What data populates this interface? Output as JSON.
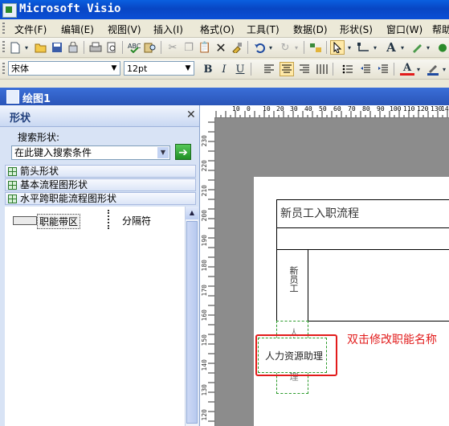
{
  "window": {
    "title": "Microsoft Visio"
  },
  "menu": [
    "文件(F)",
    "编辑(E)",
    "视图(V)",
    "插入(I)",
    "格式(O)",
    "工具(T)",
    "数据(D)",
    "形状(S)",
    "窗口(W)",
    "帮助"
  ],
  "format_toolbar": {
    "font": "宋体",
    "size": "12pt",
    "bold": "B",
    "italic": "I",
    "underline": "U",
    "font_color_letter": "A"
  },
  "document": {
    "title": "绘图1"
  },
  "shapes_panel": {
    "title": "形状",
    "search_label": "搜索形状:",
    "search_placeholder": "在此键入搜索条件",
    "stencils": [
      "箭头形状",
      "基本流程图形状",
      "水平跨职能流程图形状"
    ],
    "masters": [
      "职能带区",
      "分隔符"
    ]
  },
  "rulers": {
    "horizontal": [
      "10",
      "0",
      "10",
      "20",
      "30",
      "40",
      "50",
      "60",
      "70",
      "80",
      "90",
      "100",
      "110",
      "120",
      "130",
      "140"
    ],
    "vertical": [
      "230",
      "220",
      "210",
      "200",
      "190",
      "180",
      "170",
      "160",
      "150",
      "140",
      "130",
      "120"
    ]
  },
  "canvas": {
    "flow_title": "新员工入职流程",
    "band_new_employee": "新员工",
    "band_hr_partial": "人力资源助理",
    "edit_box_text": "人力资源助理",
    "annotation": "双击修改职能名称"
  },
  "colors": {
    "accent_red": "#e21b1b",
    "title_blue": "#0846c4"
  }
}
